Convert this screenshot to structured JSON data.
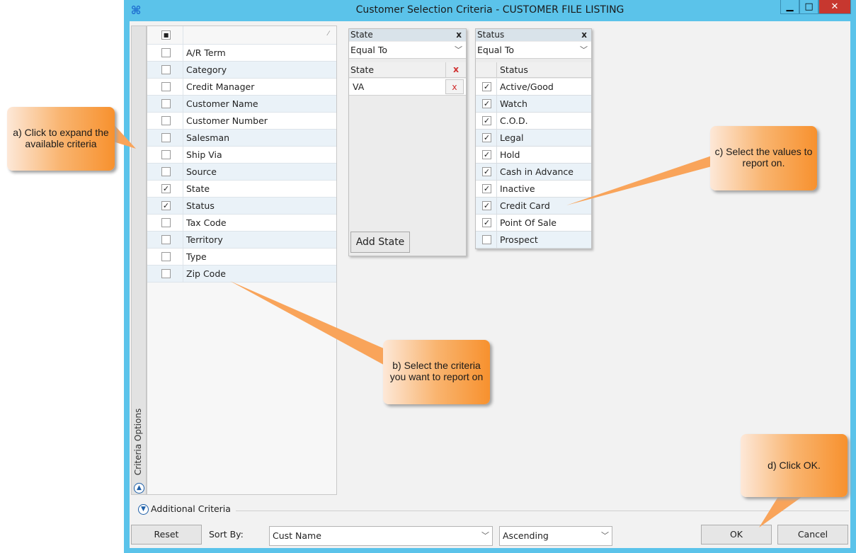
{
  "window": {
    "title": "Customer Selection Criteria - CUSTOMER FILE LISTING",
    "min_glyph": "▁",
    "max_glyph": "□",
    "close_glyph": "✕"
  },
  "criteria_panel": {
    "side_tab_label": "Criteria Options",
    "header_checkbox_glyph": "■",
    "items": [
      {
        "label": "A/R Term",
        "checked": false
      },
      {
        "label": "Category",
        "checked": false
      },
      {
        "label": "Credit Manager",
        "checked": false
      },
      {
        "label": "Customer Name",
        "checked": false
      },
      {
        "label": "Customer Number",
        "checked": false
      },
      {
        "label": "Salesman",
        "checked": false
      },
      {
        "label": "Ship Via",
        "checked": false
      },
      {
        "label": "Source",
        "checked": false
      },
      {
        "label": "State",
        "checked": true
      },
      {
        "label": "Status",
        "checked": true
      },
      {
        "label": "Tax Code",
        "checked": false
      },
      {
        "label": "Territory",
        "checked": false
      },
      {
        "label": "Type",
        "checked": false
      },
      {
        "label": "Zip Code",
        "checked": false
      }
    ]
  },
  "state_panel": {
    "title": "State",
    "close": "x",
    "operator": "Equal To",
    "column_header": "State",
    "values": [
      "VA"
    ],
    "remove": "x",
    "add_button": "Add State"
  },
  "status_panel": {
    "title": "Status",
    "close": "x",
    "operator": "Equal To",
    "column_header": "Status",
    "items": [
      {
        "label": "Active/Good",
        "checked": true
      },
      {
        "label": "Watch",
        "checked": true
      },
      {
        "label": "C.O.D.",
        "checked": true
      },
      {
        "label": "Legal",
        "checked": true
      },
      {
        "label": "Hold",
        "checked": true
      },
      {
        "label": "Cash in Advance",
        "checked": true
      },
      {
        "label": "Inactive",
        "checked": true
      },
      {
        "label": "Credit Card",
        "checked": true
      },
      {
        "label": "Point Of Sale",
        "checked": true
      },
      {
        "label": "Prospect",
        "checked": false
      }
    ]
  },
  "bottom": {
    "additional_criteria": "Additional Criteria",
    "reset": "Reset",
    "sort_by_label": "Sort By:",
    "sort_by_value": "Cust Name",
    "order_value": "Ascending",
    "ok": "OK",
    "cancel": "Cancel"
  },
  "callouts": {
    "a": "a) Click to expand the available criteria",
    "b": "b) Select the criteria you want to report on",
    "c": "c) Select the values to report on.",
    "d": "d) Click OK."
  },
  "colors": {
    "window_frame": "#5bc3ea",
    "close_button": "#c7372f",
    "callout_orange": "#f7912e",
    "remove_x": "#d03030"
  }
}
